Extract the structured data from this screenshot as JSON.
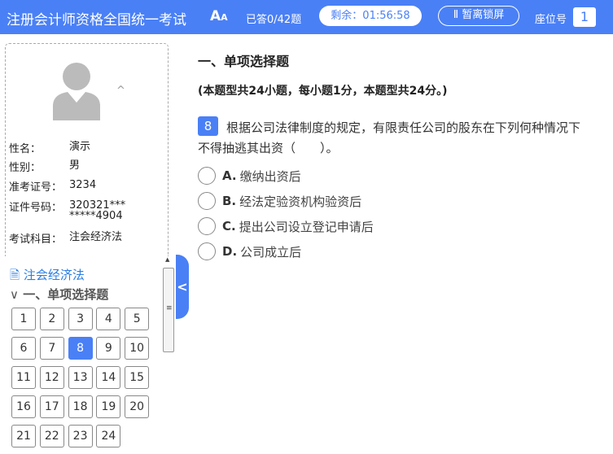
{
  "header": {
    "title": "注册会计师资格全国统一考试",
    "font_size_icon": "Aa",
    "answered": "已答0/42题",
    "timer": "剩余：01:56:58",
    "lock_button": "Ⅱ 暂离锁屏",
    "seat_label": "座位号",
    "seat_number": "1"
  },
  "profile": {
    "fields": [
      {
        "label": "性名：",
        "value": "演示"
      },
      {
        "label": "性别：",
        "value": "男"
      },
      {
        "label": "准考证号：",
        "value": "3234"
      },
      {
        "label": "证件号码：",
        "value": "320321********4904"
      },
      {
        "label": "考试科目：",
        "value": "注会经济法"
      }
    ]
  },
  "nav": {
    "subject": "注会经济法",
    "section": "一、单项选择题",
    "questions": [
      "1",
      "2",
      "3",
      "4",
      "5",
      "6",
      "7",
      "8",
      "9",
      "10",
      "11",
      "12",
      "13",
      "14",
      "15",
      "16",
      "17",
      "18",
      "19",
      "20",
      "21",
      "22",
      "23",
      "24"
    ],
    "current": "8"
  },
  "main": {
    "section_title": "一、单项选择题",
    "section_desc": "(本题型共24小题，每小题1分，本题型共24分。)",
    "question_number": "8",
    "question_text": "根据公司法律制度的规定，有限责任公司的股东在下列何种情况下不得抽逃其出资（　　）。",
    "options": [
      {
        "key": "A.",
        "text": "缴纳出资后"
      },
      {
        "key": "B.",
        "text": "经法定验资机构验资后"
      },
      {
        "key": "C.",
        "text": "提出公司设立登记申请后"
      },
      {
        "key": "D.",
        "text": "公司成立后"
      }
    ]
  },
  "colors": {
    "accent": "#4a80f6"
  }
}
